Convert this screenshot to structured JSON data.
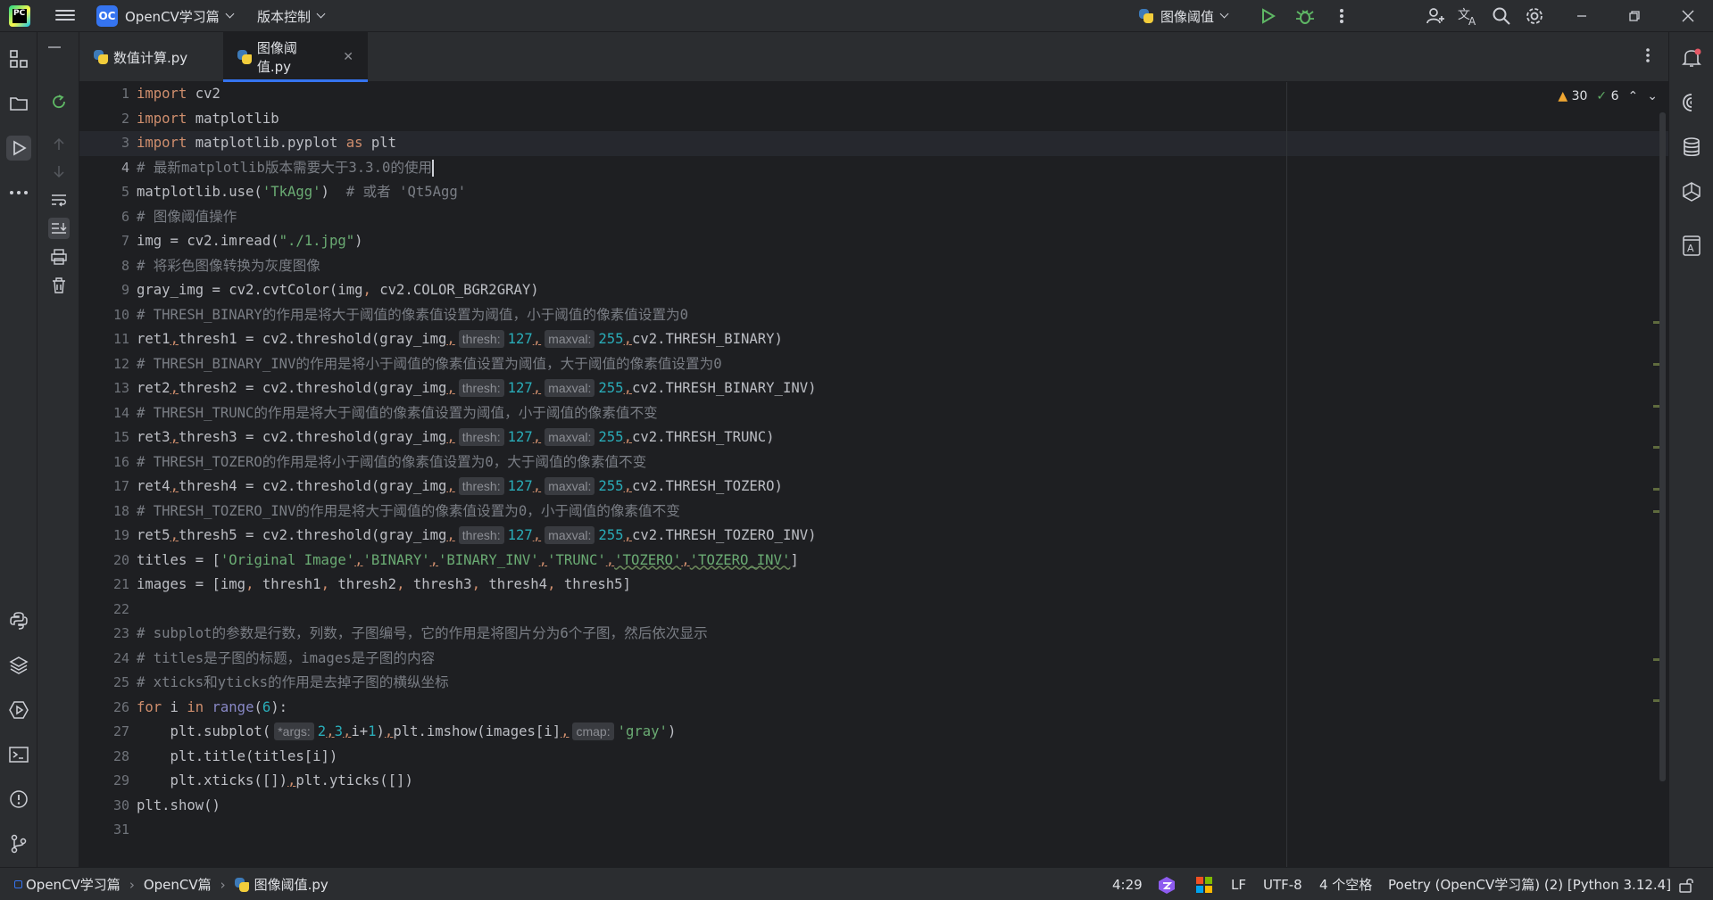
{
  "titlebar": {
    "project_badge": "OC",
    "project_name": "OpenCV学习篇",
    "vcs_label": "版本控制",
    "run_config": "图像阈值"
  },
  "tabs": [
    {
      "label": "数值计算.py",
      "active": false
    },
    {
      "label": "图像阈值.py",
      "active": true
    }
  ],
  "inspections": {
    "warnings": "30",
    "ok": "6"
  },
  "editor": {
    "current_line": 4,
    "lines": [
      "1",
      "2",
      "3",
      "4",
      "5",
      "6",
      "7",
      "8",
      "9",
      "10",
      "11",
      "12",
      "13",
      "14",
      "15",
      "16",
      "17",
      "18",
      "19",
      "20",
      "21",
      "22",
      "23",
      "24",
      "25",
      "26",
      "27",
      "28",
      "29",
      "30",
      "31"
    ],
    "code": {
      "l1": [
        "import",
        " cv2"
      ],
      "l2": [
        "import",
        " matplotlib"
      ],
      "l3": [
        "import",
        " matplotlib.pyplot ",
        "as",
        " plt"
      ],
      "l4": "# 最新matplotlib版本需要大于3.3.0的使用",
      "l5": [
        "matplotlib.use(",
        "'TkAgg'",
        ")  ",
        "# 或者 'Qt5Agg'"
      ],
      "l6": "# 图像阈值操作",
      "l7": [
        "img = cv2.imread(",
        "\"./1.jpg\"",
        ")"
      ],
      "l8": "# 将彩色图像转换为灰度图像",
      "l9": [
        "gray_img = cv2.cvtColor(img",
        ",",
        " cv2.COLOR_BGR2GRAY)"
      ],
      "l10": "# THRESH_BINARY的作用是将大于阈值的像素值设置为阈值，小于阈值的像素值设置为0",
      "l11": [
        "ret1",
        ",",
        "thresh1 = cv2.threshold(gray_img",
        ",",
        "thresh:",
        "127",
        ",",
        "maxval:",
        "255",
        ",",
        "cv2.THRESH_BINARY)"
      ],
      "l12": "# THRESH_BINARY_INV的作用是将小于阈值的像素值设置为阈值，大于阈值的像素值设置为0",
      "l13": [
        "ret2",
        ",",
        "thresh2 = cv2.threshold(gray_img",
        ",",
        "thresh:",
        "127",
        ",",
        "maxval:",
        "255",
        ",",
        "cv2.THRESH_BINARY_INV)"
      ],
      "l14": "# THRESH_TRUNC的作用是将大于阈值的像素值设置为阈值，小于阈值的像素值不变",
      "l15": [
        "ret3",
        ",",
        "thresh3 = cv2.threshold(gray_img",
        ",",
        "thresh:",
        "127",
        ",",
        "maxval:",
        "255",
        ",",
        "cv2.THRESH_TRUNC)"
      ],
      "l16": "# THRESH_TOZERO的作用是将小于阈值的像素值设置为0，大于阈值的像素值不变",
      "l17": [
        "ret4",
        ",",
        "thresh4 = cv2.threshold(gray_img",
        ",",
        "thresh:",
        "127",
        ",",
        "maxval:",
        "255",
        ",",
        "cv2.THRESH_TOZERO)"
      ],
      "l18": "# THRESH_TOZERO_INV的作用是将大于阈值的像素值设置为0，小于阈值的像素值不变",
      "l19": [
        "ret5",
        ",",
        "thresh5 = cv2.threshold(gray_img",
        ",",
        "thresh:",
        "127",
        ",",
        "maxval:",
        "255",
        ",",
        "cv2.THRESH_TOZERO_INV)"
      ],
      "l20": [
        "titles = [",
        "'Original Image'",
        ",",
        "'BINARY'",
        ",",
        "'BINARY_INV'",
        ",",
        "'TRUNC'",
        ",",
        "'TOZERO'",
        ",",
        "'TOZERO_INV'",
        "]"
      ],
      "l21": [
        "images = [img",
        ",",
        " thresh1",
        ",",
        " thresh2",
        ",",
        " thresh3",
        ",",
        " thresh4",
        ",",
        " thresh5]"
      ],
      "l23": "# subplot的参数是行数，列数，子图编号，它的作用是将图片分为6个子图，然后依次显示",
      "l24": "# titles是子图的标题，images是子图的内容",
      "l25": "# xticks和yticks的作用是去掉子图的横纵坐标",
      "l26": [
        "for",
        " i ",
        "in",
        " ",
        "range",
        "(",
        "6",
        "):"
      ],
      "l27": [
        "    plt.subplot(",
        "*args:",
        "2",
        ",",
        "3",
        ",",
        "i+",
        "1",
        ")",
        ",",
        "plt.imshow(images[i]",
        ",",
        "cmap:",
        "'gray'",
        ")"
      ],
      "l28": "    plt.title(titles[i])",
      "l29": [
        "    plt.xticks([])",
        ",",
        "plt.yticks([])"
      ],
      "l30": "plt.show()"
    }
  },
  "statusbar": {
    "crumb1": "OpenCV学习篇",
    "crumb2": "OpenCV篇",
    "crumb3": "图像阈值.py",
    "position": "4:29",
    "line_sep": "LF",
    "encoding": "UTF-8",
    "indent": "4 个空格",
    "interpreter": "Poetry (OpenCV学习篇) (2) [Python 3.12.4]"
  },
  "colors": {
    "keyword": "#cf8e6d",
    "string": "#6aab73",
    "number": "#2aacb8",
    "comment": "#7a7e85",
    "accent": "#3574f0"
  }
}
